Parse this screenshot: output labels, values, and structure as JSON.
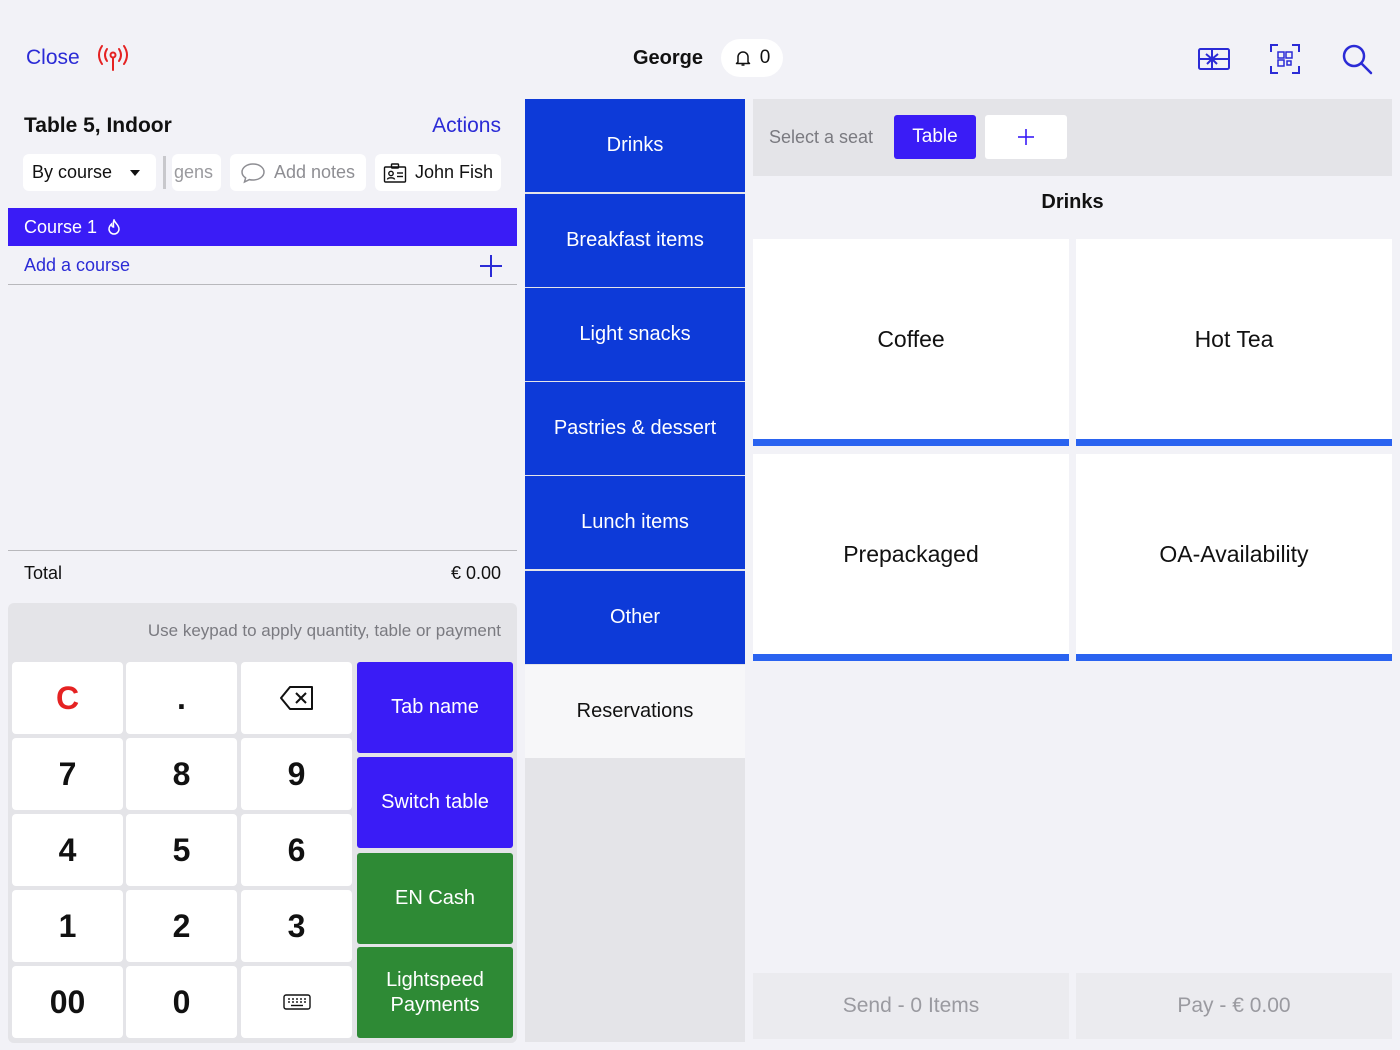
{
  "header": {
    "close_label": "Close",
    "user_name": "George",
    "notification_count": "0",
    "accent_color": "#2b2bd6",
    "signal_color": "#e52222"
  },
  "order": {
    "title": "Table 5, Indoor",
    "actions_label": "Actions",
    "mode_label": "By course",
    "allergens_label": "gens",
    "notes_placeholder": "Add notes",
    "customer_name": "John Fish",
    "course_label": "Course 1",
    "add_course_label": "Add a course",
    "total_label": "Total",
    "total_value": "€ 0.00"
  },
  "keypad": {
    "hint": "Use keypad to apply quantity, table or payment",
    "clear": "C",
    "dot": ".",
    "k7": "7",
    "k8": "8",
    "k9": "9",
    "k4": "4",
    "k5": "5",
    "k6": "6",
    "k1": "1",
    "k2": "2",
    "k3": "3",
    "k00": "00",
    "k0": "0"
  },
  "actions": {
    "tab_name": "Tab name",
    "switch_table": "Switch table",
    "cash": "EN Cash",
    "lightspeed": "Lightspeed Payments"
  },
  "categories": [
    {
      "label": "Drinks"
    },
    {
      "label": "Breakfast items"
    },
    {
      "label": "Light snacks"
    },
    {
      "label": "Pastries & dessert"
    },
    {
      "label": "Lunch items"
    },
    {
      "label": "Other"
    },
    {
      "label": "Reservations"
    }
  ],
  "seats": {
    "select_label": "Select a seat",
    "table_label": "Table"
  },
  "products": {
    "header": "Drinks",
    "items": [
      {
        "label": "Coffee"
      },
      {
        "label": "Hot Tea"
      },
      {
        "label": "Prepackaged"
      },
      {
        "label": "OA-Availability"
      }
    ]
  },
  "footer": {
    "send_label": "Send - 0 Items",
    "pay_label": "Pay - € 0.00"
  }
}
